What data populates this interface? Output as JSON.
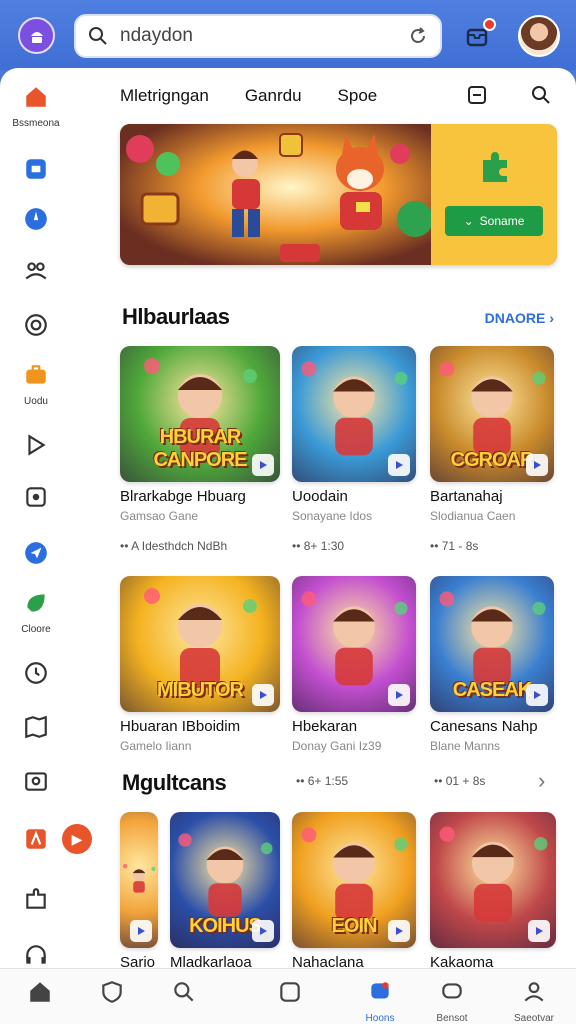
{
  "search": {
    "value": "ndaydon"
  },
  "tabs": [
    "Mletrigngan",
    "Ganrdu",
    "Spoe"
  ],
  "sidebar": {
    "items": [
      {
        "icon": "home-icon",
        "label": "Bssmeona",
        "color": "#e8552b"
      },
      {
        "icon": "store-icon",
        "label": "",
        "color": "#2b6ee0"
      },
      {
        "icon": "compass-icon",
        "label": "",
        "color": "#2b6ee0"
      },
      {
        "icon": "people-icon",
        "label": "",
        "color": "#333333"
      },
      {
        "icon": "at-icon",
        "label": "",
        "color": "#333333"
      },
      {
        "icon": "briefcase-icon",
        "label": "Uodu",
        "color": "#f0941e"
      },
      {
        "icon": "play-icon",
        "label": "",
        "color": "#333333"
      },
      {
        "icon": "gamepad-icon",
        "label": "",
        "color": "#333333"
      },
      {
        "icon": "send-icon",
        "label": "",
        "color": "#2b6ee0"
      },
      {
        "icon": "leaf-icon",
        "label": "Cloore",
        "color": "#2aa04a"
      },
      {
        "icon": "clock-icon",
        "label": "",
        "color": "#333333"
      },
      {
        "icon": "map-icon",
        "label": "",
        "color": "#333333"
      },
      {
        "icon": "tv-icon",
        "label": "",
        "color": "#333333"
      },
      {
        "icon": "app-icon",
        "label": "",
        "color": "#e8552b"
      },
      {
        "icon": "puzzle-icon",
        "label": "",
        "color": "#333333"
      },
      {
        "icon": "headset-icon",
        "label": "",
        "color": "#333333"
      }
    ]
  },
  "banner": {
    "button_label": "Soname"
  },
  "sections": [
    {
      "title": "Hlbaurlaas",
      "see_more": "Dnaore",
      "rows": [
        [
          {
            "name": "Blrarkabge Hbuarg",
            "sub": "Gamsao Gane",
            "meta": "•• A Idesthdch NdBh",
            "overlay": "HBURAR CANPORE",
            "bg": "#4fa83a"
          },
          {
            "name": "Uoodain",
            "sub": "Sonayane Idos",
            "meta": "•• 8+ 1:30",
            "overlay": "",
            "bg": "#3b9ad6"
          },
          {
            "name": "Bartanahaj",
            "sub": "Slodianua Caen",
            "meta": "•• 71 - 8s",
            "overlay": "CGROAR",
            "bg": "#c98a2b"
          }
        ],
        [
          {
            "name": "Hbuaran IBboidim",
            "sub": "Gamelo Iiann",
            "meta": "",
            "overlay": "MIBUTOR",
            "bg": "#f4b21f"
          },
          {
            "name": "Hbekaran",
            "sub": "Donay Gani Iz39",
            "meta": "",
            "overlay": "",
            "bg": "#c34fd0"
          },
          {
            "name": "Canesans Nahp",
            "sub": "Blane Manns",
            "meta": "",
            "overlay": "CASEAK",
            "bg": "#3a7fd0"
          }
        ]
      ]
    },
    {
      "title": "Mgultcans",
      "meta_left": "•• 6+ 1:55",
      "meta_right": "•• 01 + 8s",
      "cards": [
        {
          "name": "Sario",
          "overlay": "",
          "bg": "#f2a43a"
        },
        {
          "name": "Mladkarlaoa",
          "overlay": "KOIHUS",
          "bg": "#2b4fa8"
        },
        {
          "name": "Nahaclana",
          "overlay": "EOIN",
          "bg": "#f0a020"
        },
        {
          "name": "Kakaoma",
          "overlay": "",
          "bg": "#c0484a"
        }
      ]
    }
  ],
  "bottom_nav": [
    {
      "icon": "home-icon",
      "label": ""
    },
    {
      "icon": "shield-icon",
      "label": ""
    },
    {
      "icon": "search-icon",
      "label": ""
    },
    {
      "icon": "square-icon",
      "label": ""
    },
    {
      "icon": "games-icon",
      "label": "Hoons",
      "active": true
    },
    {
      "icon": "chat-icon",
      "label": "Bensot"
    },
    {
      "icon": "profile-icon",
      "label": "Saeotvar"
    }
  ],
  "colors": {
    "accent": "#2b6ee0",
    "header": "#4a78d8",
    "play_green": "#1e9b45"
  }
}
